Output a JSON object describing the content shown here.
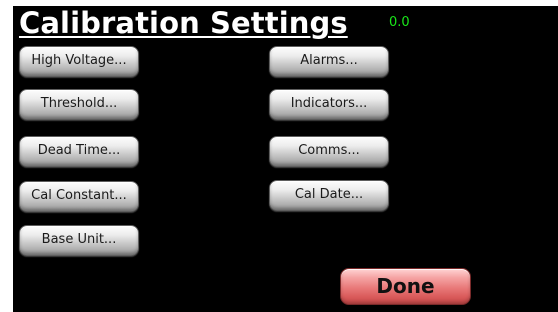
{
  "header": {
    "title": "Calibration Settings",
    "counter": "0.0"
  },
  "left_column": [
    {
      "label": "High Voltage..."
    },
    {
      "label": "Threshold..."
    },
    {
      "label": "Dead Time..."
    },
    {
      "label": "Cal Constant..."
    },
    {
      "label": "Base Unit..."
    }
  ],
  "right_column": [
    {
      "label": "Alarms..."
    },
    {
      "label": "Indicators..."
    },
    {
      "label": "Comms..."
    },
    {
      "label": "Cal Date..."
    }
  ],
  "footer": {
    "done_label": "Done"
  },
  "colors": {
    "background": "#000000",
    "title": "#ffffff",
    "counter": "#19e619",
    "done_button": "#e87878",
    "button_face": "#d0d0d0"
  }
}
